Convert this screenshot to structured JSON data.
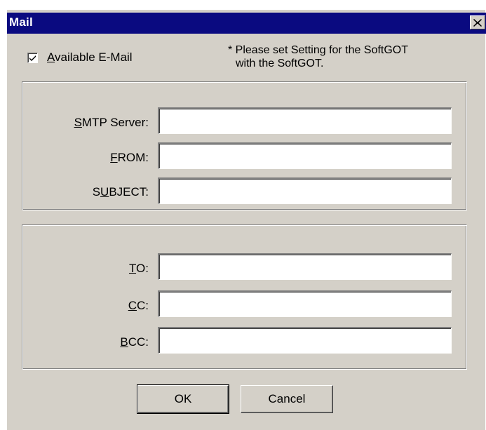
{
  "window": {
    "title": "Mail",
    "close_icon": "close-icon"
  },
  "email_option": {
    "checkbox_checked": true,
    "label_first": "A",
    "label_rest": "vailable E-Mail",
    "note_line1": "* Please set Setting for the SoftGOT",
    "note_line2": "with the SoftGOT."
  },
  "server_group": {
    "smtp": {
      "label_first": "S",
      "label_rest": "MTP Server:",
      "value": ""
    },
    "from": {
      "label_first": "F",
      "label_rest": "ROM:",
      "value": ""
    },
    "subject": {
      "label_pre": "S",
      "label_first": "U",
      "label_rest": "BJECT:",
      "value": ""
    }
  },
  "recipients_group": {
    "to": {
      "label_first": "T",
      "label_rest": "O:",
      "value": ""
    },
    "cc": {
      "label_first": "C",
      "label_rest": "C:",
      "value": ""
    },
    "bcc": {
      "label_first": "B",
      "label_rest": "CC:",
      "value": ""
    }
  },
  "buttons": {
    "ok_label": "OK",
    "cancel_label": "Cancel"
  },
  "colors": {
    "title_bar": "#0a0a80",
    "dialog_face": "#d4d0c8",
    "field_background": "#ffffff"
  }
}
